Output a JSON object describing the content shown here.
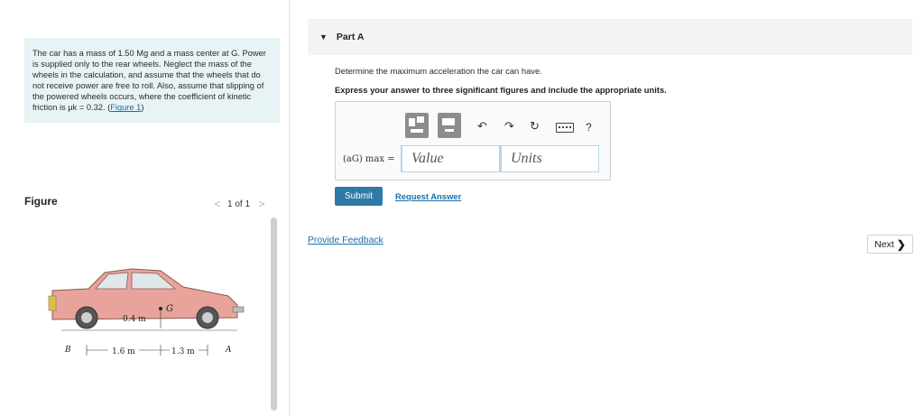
{
  "problem": {
    "text_before_link": "The car has a mass of 1.50 Mg and a mass center at G. Power is supplied only to the rear wheels. Neglect the mass of the wheels in the calculation, and assume that the wheels that do not receive power are free to roll. Also, assume that slipping of the powered wheels occurs, where the coefficient of kinetic friction is μk = 0.32. (",
    "link_label": "Figure 1",
    "text_after_link": ")"
  },
  "figure": {
    "title": "Figure",
    "prev": "<",
    "counter": "1 of 1",
    "next": ">",
    "labels": {
      "height": "0.4 m",
      "center": "G",
      "rear": "B",
      "front": "A",
      "dist_rear": "1.6 m",
      "dist_front": "1.3 m"
    }
  },
  "part": {
    "caret": "▼",
    "title": "Part A",
    "question": "Determine the maximum acceleration the car can have.",
    "instruction": "Express your answer to three significant figures and include the appropriate units."
  },
  "toolbar": {
    "undo": "↶",
    "redo": "↷",
    "reset": "↻",
    "help": "?"
  },
  "answer": {
    "label": "(aG) max =",
    "value_placeholder": "Value",
    "units_placeholder": "Units"
  },
  "actions": {
    "submit": "Submit",
    "request_answer": "Request Answer",
    "provide_feedback": "Provide Feedback",
    "next": "Next",
    "next_chevron": "❯"
  },
  "colors": {
    "problem_bg": "#e8f3f6",
    "submit_bg": "#2f7aa5",
    "link": "#1a6fa8",
    "car_body": "#e8a49a"
  }
}
